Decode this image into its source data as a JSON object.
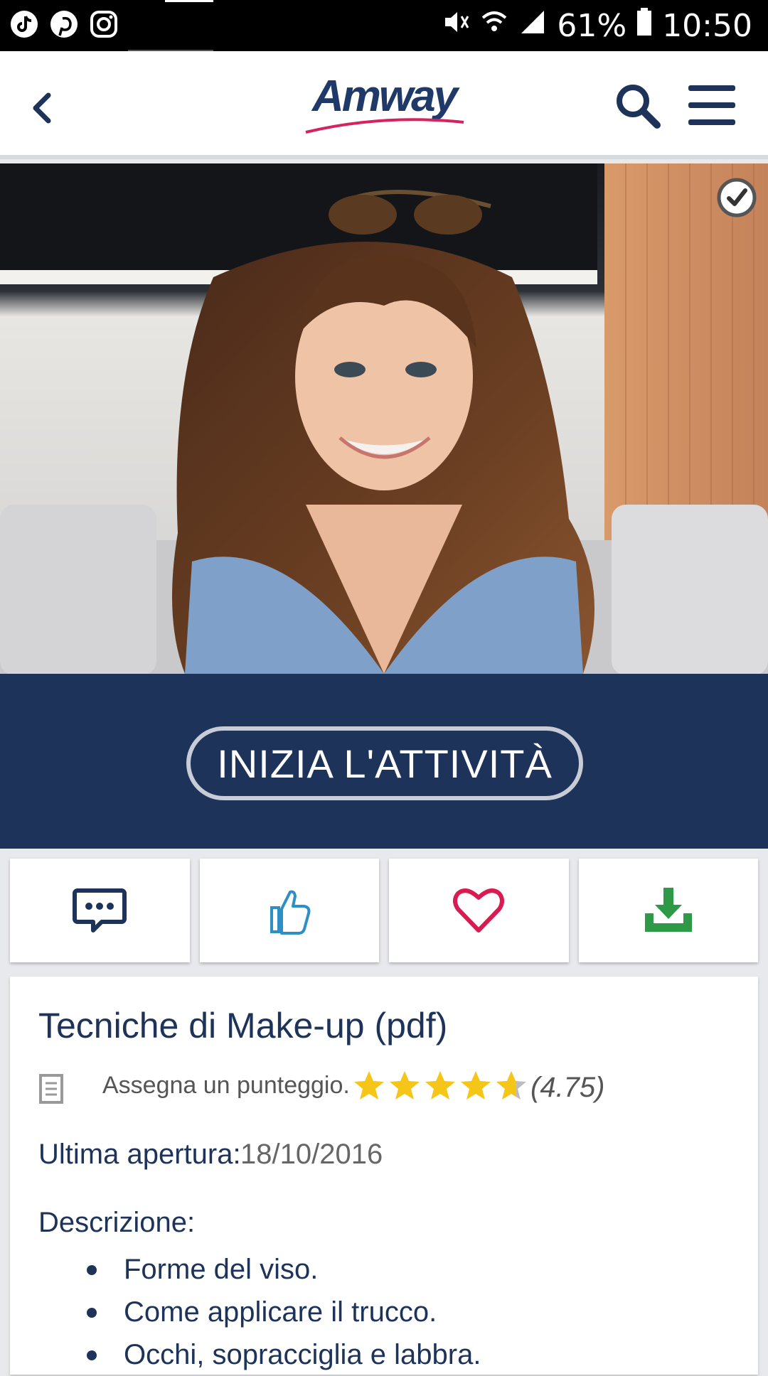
{
  "status_bar": {
    "battery": "61%",
    "time": "10:50",
    "notification_icons": [
      "tiktok-icon",
      "pinterest-icon",
      "instagram-icon"
    ],
    "system_icons": [
      "mute-icon",
      "wifi-icon",
      "signal-icon",
      "battery-icon"
    ]
  },
  "app_bar": {
    "logo": "Amway",
    "icons": [
      "back-icon",
      "search-icon",
      "menu-icon"
    ]
  },
  "hero": {
    "completed_icon": "checkmark-icon"
  },
  "cta": {
    "label": "INIZIA L'ATTIVITÀ"
  },
  "actions": [
    {
      "icon": "comment-icon",
      "color": "#1d3359"
    },
    {
      "icon": "thumbs-up-icon",
      "color": "#2d8fc4"
    },
    {
      "icon": "heart-icon",
      "color": "#d81b50"
    },
    {
      "icon": "download-icon",
      "color": "#2e9a48"
    }
  ],
  "content": {
    "title": "Tecniche di Make-up (pdf)",
    "rate_prompt": "Assegna un punteggio.",
    "rating": 4.75,
    "rating_text": "(4.75)",
    "last_opened_label": "Ultima apertura:",
    "last_opened_value": "18/10/2016",
    "description_label": "Descrizione:",
    "description_items": [
      "Forme del viso.",
      "Come applicare il trucco.",
      "Occhi, sopracciglia e labbra."
    ]
  },
  "colors": {
    "brand_navy": "#1d3359",
    "star": "#f5c518"
  }
}
